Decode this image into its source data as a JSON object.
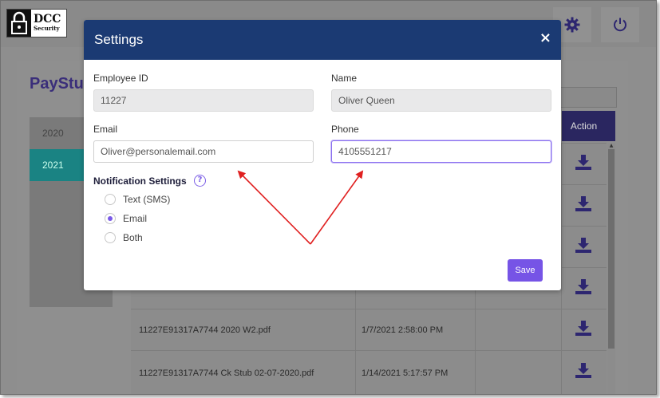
{
  "app": {
    "logo_line1": "DCC",
    "logo_line2": "Security"
  },
  "page": {
    "title": "PayStu"
  },
  "years": [
    "2020",
    "2021"
  ],
  "table": {
    "action_header": "Action",
    "rows": [
      {
        "file": "11227E91317A7744 2020 W2.pdf",
        "date": "1/7/2021 2:58:00 PM"
      },
      {
        "file": "11227E91317A7744 Ck Stub 02-07-2020.pdf",
        "date": "1/14/2021 5:17:57 PM"
      }
    ]
  },
  "modal": {
    "title": "Settings",
    "close_label": "×",
    "employee_id_label": "Employee ID",
    "employee_id_value": "11227",
    "name_label": "Name",
    "name_value": "Oliver Queen",
    "email_label": "Email",
    "email_value": "Oliver@personalemail.com",
    "phone_label": "Phone",
    "phone_value": "4105551217",
    "notification_label": "Notification Settings",
    "notification_options": [
      {
        "label": "Text (SMS)",
        "checked": false
      },
      {
        "label": "Email",
        "checked": true
      },
      {
        "label": "Both",
        "checked": false
      }
    ],
    "save_label": "Save"
  },
  "colors": {
    "modal_header": "#1b3a73",
    "accent": "#7654e6",
    "annotation_arrow": "#e02020"
  }
}
